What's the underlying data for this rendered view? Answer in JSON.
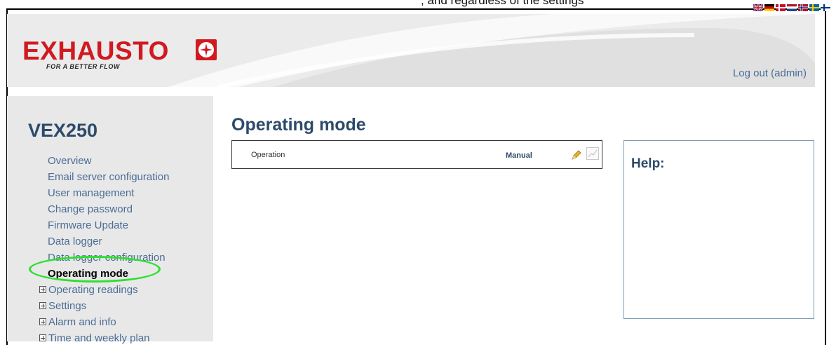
{
  "caption": ", and regardless of the settings",
  "languages": [
    {
      "name": "english-flag",
      "colors": [
        "#012169",
        "#c8102e",
        "#ffffff"
      ]
    },
    {
      "name": "german-flag",
      "colors": [
        "#000000",
        "#dd0000",
        "#ffce00"
      ]
    },
    {
      "name": "danish-flag",
      "colors": [
        "#c8102e",
        "#ffffff"
      ]
    },
    {
      "name": "dutch-flag",
      "colors": [
        "#ae1c28",
        "#ffffff",
        "#21468b"
      ]
    },
    {
      "name": "norwegian-flag",
      "colors": [
        "#ba0c2f",
        "#ffffff",
        "#00205b"
      ]
    },
    {
      "name": "swedish-flag",
      "colors": [
        "#006aa7",
        "#fecc00"
      ]
    },
    {
      "name": "finnish-flag",
      "colors": [
        "#ffffff",
        "#003580"
      ]
    }
  ],
  "header": {
    "brand": "EXHAUSTO",
    "tagline": "FOR A BETTER FLOW",
    "logout_label": "Log out (admin)"
  },
  "sidebar": {
    "device_title": "VEX250",
    "items": [
      {
        "label": "Overview"
      },
      {
        "label": "Email server configuration"
      },
      {
        "label": "User management"
      },
      {
        "label": "Change password"
      },
      {
        "label": "Firmware Update"
      },
      {
        "label": "Data logger"
      },
      {
        "label": "Data logger configuration"
      },
      {
        "label": "Operating mode",
        "active": true
      },
      {
        "label": "Operating readings",
        "expandable": true
      },
      {
        "label": "Settings",
        "expandable": true
      },
      {
        "label": "Alarm and info",
        "expandable": true
      },
      {
        "label": "Time and weekly plan",
        "expandable": true
      }
    ]
  },
  "main": {
    "page_title": "Operating mode",
    "operation_label": "Operation",
    "operation_value": "Manual"
  },
  "help": {
    "title": "Help:"
  },
  "colors": {
    "brand_red": "#d01a20",
    "link_blue": "#4a6e96",
    "title_blue": "#2d4a6a",
    "highlight_green": "#2ee02e"
  }
}
